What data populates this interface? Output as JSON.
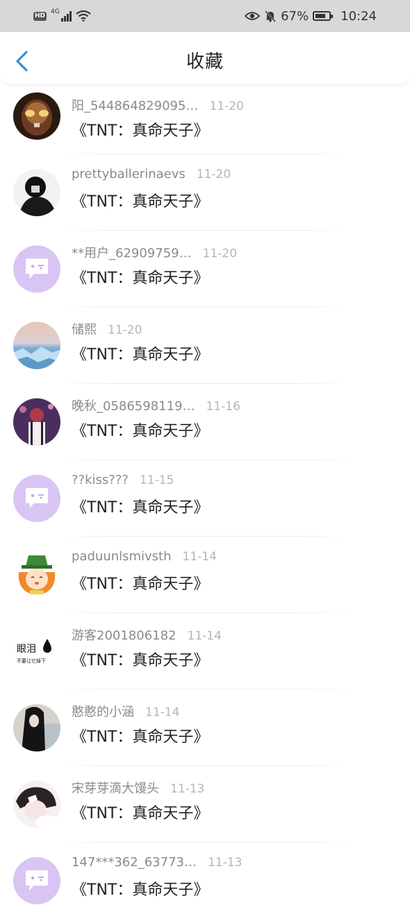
{
  "status_bar": {
    "hd": "HD",
    "network": "4G",
    "battery_percent": "67%",
    "time": "10:24"
  },
  "header": {
    "title": "收藏"
  },
  "items": [
    {
      "user": "阳_544864829095…",
      "date": "11-20",
      "content": "《TNT：真命天子》",
      "avatar": "red-robot-photo"
    },
    {
      "user": "prettyballerinaevs",
      "date": "11-20",
      "content": "《TNT：真命天子》",
      "avatar": "dark-person-photo"
    },
    {
      "user": "**用户_62909759…",
      "date": "11-20",
      "content": "《TNT：真命天子》",
      "avatar": "default-chat-avatar"
    },
    {
      "user": "储熙",
      "date": "11-20",
      "content": "《TNT：真命天子》",
      "avatar": "sea-ice-photo"
    },
    {
      "user": "晚秋_0586598119…",
      "date": "11-16",
      "content": "《TNT：真命天子》",
      "avatar": "pink-girl-photo"
    },
    {
      "user": "??kiss???",
      "date": "11-15",
      "content": "《TNT：真命天子》",
      "avatar": "default-chat-avatar"
    },
    {
      "user": "paduunlsmivsth",
      "date": "11-14",
      "content": "《TNT：真命天子》",
      "avatar": "cartoon-hat-avatar"
    },
    {
      "user": "游客2001806182",
      "date": "11-14",
      "content": "《TNT：真命天子》",
      "avatar": "teardrop-text-avatar",
      "avatar_text": "眼泪",
      "avatar_subtext": "不要让它掉下"
    },
    {
      "user": "憨憨的小涵",
      "date": "11-14",
      "content": "《TNT：真命天子》",
      "avatar": "long-hair-photo"
    },
    {
      "user": "宋芽芽滴大馒头",
      "date": "11-13",
      "content": "《TNT：真命天子》",
      "avatar": "sleeping-person-photo"
    },
    {
      "user": "147***362_63773…",
      "date": "11-13",
      "content": "《TNT：真命天子》",
      "avatar": "default-chat-avatar"
    }
  ],
  "colors": {
    "accent_blue": "#2f8fe0",
    "placeholder_purple": "#d9c5f3",
    "status_bar_bg": "#d8d8d8"
  }
}
